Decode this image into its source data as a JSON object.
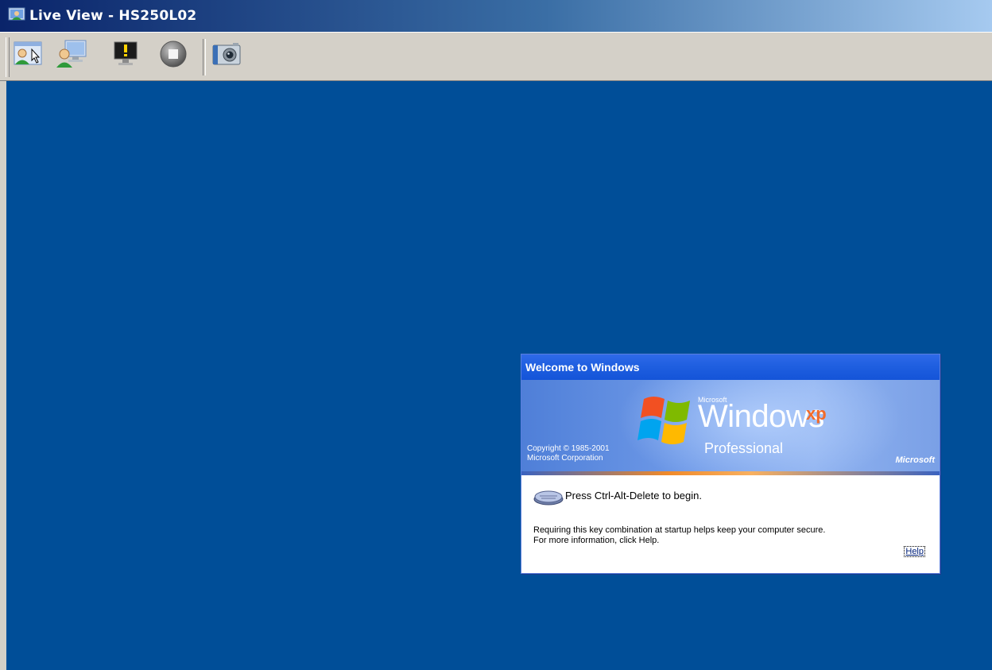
{
  "window": {
    "title": "Live View - HS250L02",
    "icon": "live-view-app-icon"
  },
  "toolbar": {
    "buttons": [
      {
        "name": "remote-control",
        "icon": "user-cursor-icon"
      },
      {
        "name": "view-only",
        "icon": "user-monitor-icon"
      },
      {
        "name": "alert-monitor",
        "icon": "monitor-warning-icon"
      },
      {
        "name": "stop",
        "icon": "stop-icon"
      },
      {
        "name": "snapshot",
        "icon": "camera-icon"
      }
    ]
  },
  "remote_screen": {
    "background_color": "#004e98",
    "dialog": {
      "title": "Welcome to Windows",
      "banner": {
        "microsoft_small": "Microsoft",
        "windows": "Windows",
        "xp": "xp",
        "edition": "Professional",
        "copyright_line1": "Copyright © 1985-2001",
        "copyright_line2": "Microsoft Corporation",
        "brand": "Microsoft"
      },
      "prompt": "Press Ctrl-Alt-Delete to begin.",
      "info": "Requiring this key combination at startup helps keep your computer secure. For more information, click Help.",
      "help_label": "Help"
    }
  }
}
